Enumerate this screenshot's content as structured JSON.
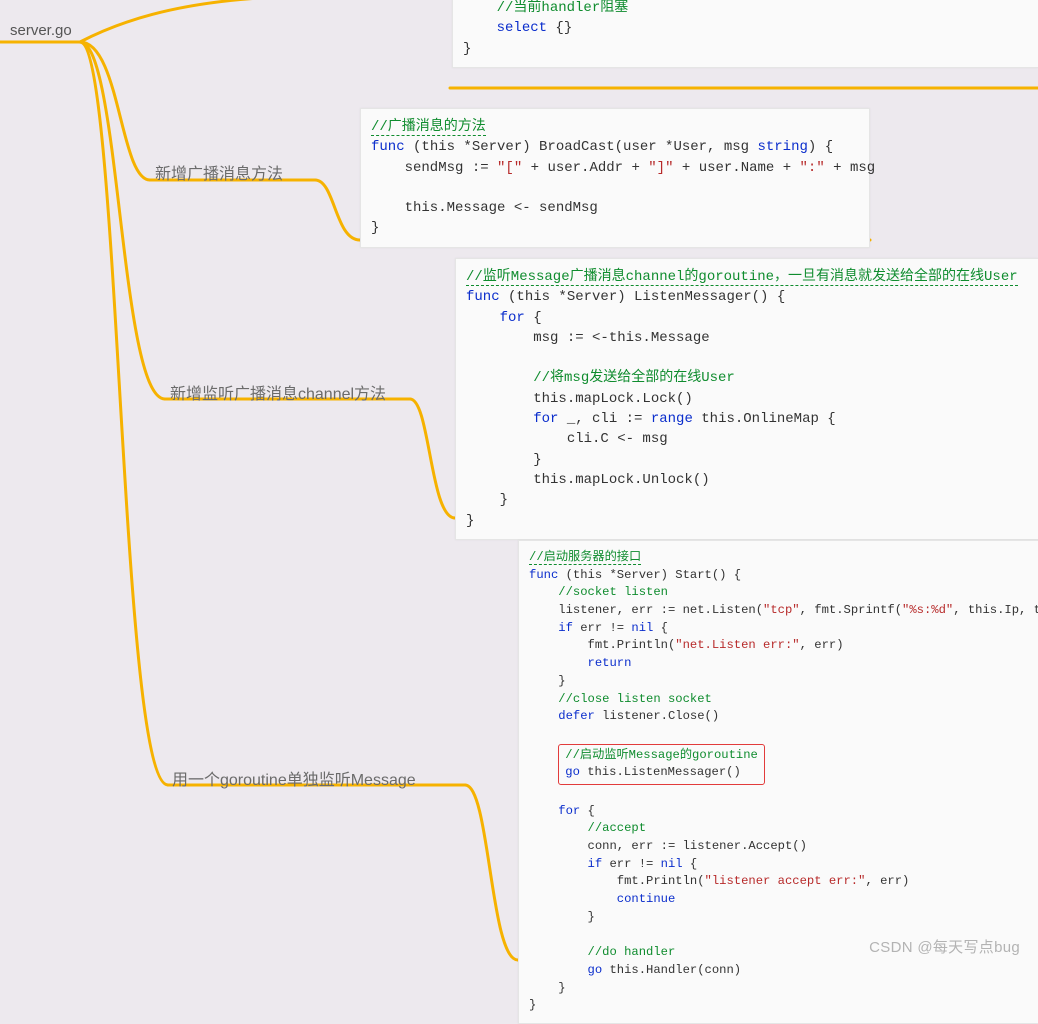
{
  "root": {
    "label": "server.go"
  },
  "nodes": {
    "broadcast": {
      "label": "新增广播消息方法"
    },
    "listen": {
      "label": "新增监听广播消息channel方法"
    },
    "goroutine": {
      "label": "用一个goroutine单独监听Message"
    }
  },
  "code_top": {
    "comment": "//当前handler阻塞",
    "l1a": "select",
    "l1b": " {}",
    "l2": "}"
  },
  "code_broadcast": {
    "comment": "//广播消息的方法",
    "l1_func": "func",
    "l1_mid": " (this *Server) BroadCast(user *User, msg ",
    "l1_str": "string",
    "l1_end": ") {",
    "l2_a": "    sendMsg := ",
    "l2_s1": "\"[\"",
    "l2_p1": " + user.Addr + ",
    "l2_s2": "\"]\"",
    "l2_p2": " + user.Name + ",
    "l2_s3": "\":\"",
    "l2_p3": " + msg",
    "l3": "",
    "l4": "    this.Message <- sendMsg",
    "l5": "}"
  },
  "code_listen": {
    "comment": "//监听Message广播消息channel的goroutine，一旦有消息就发送给全部的在线User",
    "l1_func": "func",
    "l1_rest": " (this *Server) ListenMessager() {",
    "l2_for": "    for",
    "l2_rest": " {",
    "l3": "        msg := <-this.Message",
    "l4": "",
    "l5_cm": "        //将msg发送给全部的在线User",
    "l6": "        this.mapLock.Lock()",
    "l7_for": "        for",
    "l7_mid": " _, cli := ",
    "l7_range": "range",
    "l7_rest": " this.OnlineMap {",
    "l8": "            cli.C <- msg",
    "l9": "        }",
    "l10": "        this.mapLock.Unlock()",
    "l11": "    }",
    "l12": "}"
  },
  "code_start": {
    "comment": "//启动服务器的接口",
    "l1_func": "func",
    "l1_rest": " (this *Server) Start() {",
    "l2_cm": "    //socket listen",
    "l3_a": "    listener, err := net.Listen(",
    "l3_s1": "\"tcp\"",
    "l3_b": ", fmt.Sprintf(",
    "l3_s2": "\"%s:%d\"",
    "l3_c": ", this.Ip, this.Port))",
    "l4_if": "    if",
    "l4_mid": " err != ",
    "l4_nil": "nil",
    "l4_end": " {",
    "l5_a": "        fmt.Println(",
    "l5_s": "\"net.Listen err:\"",
    "l5_b": ", err)",
    "l6_a": "        ",
    "l6_ret": "return",
    "l7": "    }",
    "l8_cm": "    //close listen socket",
    "l9_defer": "    defer",
    "l9_rest": " listener.Close()",
    "l10": "",
    "hl_cm": "//启动监听Message的goroutine",
    "hl_go": "go",
    "hl_rest": " this.ListenMessager()",
    "l12": "",
    "l13_for": "    for",
    "l13_rest": " {",
    "l14_cm": "        //accept",
    "l15": "        conn, err := listener.Accept()",
    "l16_if": "        if",
    "l16_mid": " err != ",
    "l16_nil": "nil",
    "l16_end": " {",
    "l17_a": "            fmt.Println(",
    "l17_s": "\"listener accept err:\"",
    "l17_b": ", err)",
    "l18_a": "            ",
    "l18_cont": "continue",
    "l19": "        }",
    "l20": "",
    "l21_cm": "        //do handler",
    "l22_go": "        go",
    "l22_rest": " this.Handler(conn)",
    "l23": "    }",
    "l24": "}"
  },
  "watermark": "CSDN @每天写点bug"
}
